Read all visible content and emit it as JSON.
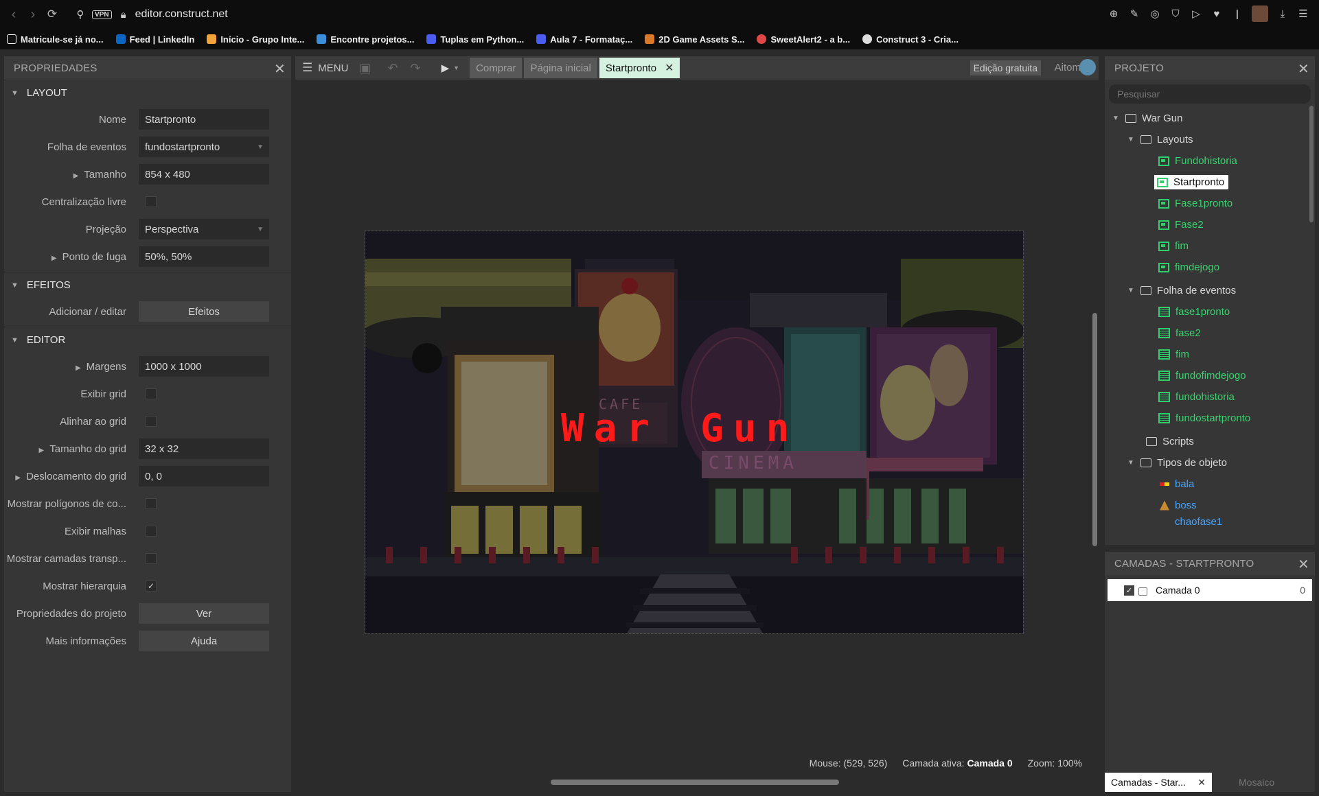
{
  "browser": {
    "vpn": "VPN",
    "url": "editor.construct.net",
    "bookmarks": [
      {
        "label": "Matricule-se já no...",
        "color": "#ffffff"
      },
      {
        "label": "Feed | LinkedIn",
        "color": "#0a66c2"
      },
      {
        "label": "Início - Grupo Inte...",
        "color": "#f2a33a"
      },
      {
        "label": "Encontre projetos...",
        "color": "#3a8fd8"
      },
      {
        "label": "Tuplas em Python...",
        "color": "#4b5cf0"
      },
      {
        "label": "Aula 7 - Formataç...",
        "color": "#4b5cf0"
      },
      {
        "label": "2D Game Assets S...",
        "color": "#d97a2b"
      },
      {
        "label": "SweetAlert2 - a b...",
        "color": "#e04848"
      },
      {
        "label": "Construct 3 - Cria...",
        "color": "#dddddd"
      }
    ]
  },
  "properties": {
    "title": "PROPRIEDADES",
    "sections": {
      "layout": "LAYOUT",
      "effects": "EFEITOS",
      "editor": "EDITOR"
    },
    "layout_rows": [
      {
        "label": "Nome",
        "value": "Startpronto"
      },
      {
        "label": "Folha de eventos",
        "value": "fundostartpronto"
      },
      {
        "label": "Tamanho",
        "value": "854 x 480"
      },
      {
        "label": "Centralização livre"
      },
      {
        "label": "Projeção",
        "value": "Perspectiva"
      },
      {
        "label": "Ponto de fuga",
        "value": "50%, 50%"
      }
    ],
    "effects_rows": [
      {
        "label": "Adicionar / editar",
        "button": "Efeitos"
      }
    ],
    "editor_rows": [
      {
        "label": "Margens",
        "value": "1000 x 1000"
      },
      {
        "label": "Exibir grid"
      },
      {
        "label": "Alinhar ao grid"
      },
      {
        "label": "Tamanho do grid",
        "value": "32 x 32"
      },
      {
        "label": "Deslocamento do grid",
        "value": "0, 0"
      },
      {
        "label": "Mostrar polígonos de co..."
      },
      {
        "label": "Exibir malhas"
      },
      {
        "label": "Mostrar camadas transp..."
      },
      {
        "label": "Mostrar hierarquia",
        "checked": "✓"
      },
      {
        "label": "Propriedades do projeto",
        "button": "Ver"
      },
      {
        "label": "Mais informações",
        "button": "Ajuda"
      }
    ]
  },
  "toolbar": {
    "menu": "MENU",
    "tabs": [
      "Comprar",
      "Página inicial",
      "Startpronto"
    ],
    "edition": "Edição gratuita",
    "user": "Aitom"
  },
  "layout_view": {
    "title_word1": "War",
    "title_word2": "Gun",
    "cafe": "CAFE",
    "cinema": "CINEMA"
  },
  "status": {
    "mouse_label": "Mouse:",
    "mouse_value": "(529, 526)",
    "layer_label": "Camada ativa:",
    "layer_value": "Camada 0",
    "zoom": "Zoom: 100%"
  },
  "project": {
    "title": "PROJETO",
    "search_placeholder": "Pesquisar",
    "root": "War Gun",
    "layouts_folder": "Layouts",
    "layouts": [
      "Fundohistoria",
      "Startpronto",
      "Fase1pronto",
      "Fase2",
      "fim",
      "fimdejogo"
    ],
    "events_folder": "Folha de eventos",
    "events": [
      "fase1pronto",
      "fase2",
      "fim",
      "fundofimdejogo",
      "fundohistoria",
      "fundostartpronto"
    ],
    "scripts_folder": "Scripts",
    "objects_folder": "Tipos de objeto",
    "objects": [
      "bala",
      "boss",
      "chaofase1"
    ]
  },
  "layers": {
    "title": "CAMADAS - STARTPRONTO",
    "layer_name": "Camada 0",
    "layer_index": "0",
    "tab_active": "Camadas - Star...",
    "tab_other": "Mosaico"
  },
  "colors": {
    "accent_green": "#39d36f",
    "object_blue": "#45a6ff",
    "active_tab": "#d4f2df"
  }
}
